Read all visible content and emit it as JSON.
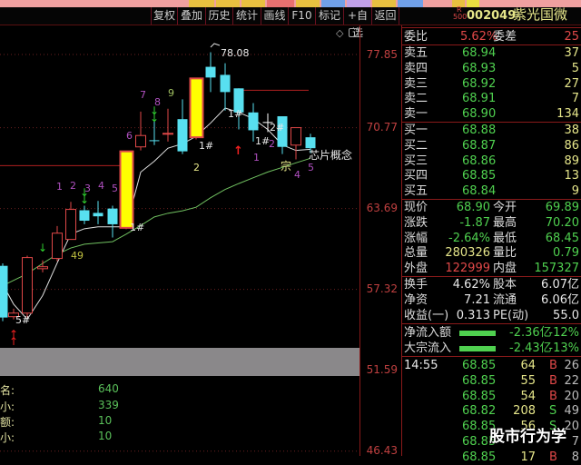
{
  "toolbar": {
    "buttons": [
      "复权",
      "叠加",
      "历史",
      "统计",
      "画线",
      "F10",
      "标记",
      "+自选",
      "返回"
    ]
  },
  "colors": {
    "up": "#e04848",
    "down": "#58e0f0",
    "limit": "#ffff00",
    "ma5": "#e0e0e0",
    "ma_long": "#70c060",
    "accent_green": "#4fd04f"
  },
  "axis": {
    "ticks": [
      "77.85",
      "70.77",
      "63.69",
      "57.32",
      "51.59",
      "46.43"
    ],
    "tick_values": [
      77.85,
      70.77,
      63.69,
      57.32,
      51.59,
      46.43
    ]
  },
  "candles": [
    {
      "o": 59.11,
      "h": 59.3,
      "l": 55.0,
      "c": 55.26,
      "t": "down"
    },
    {
      "o": 55.32,
      "h": 55.9,
      "l": 55.13,
      "c": 55.58,
      "t": "up"
    },
    {
      "o": 55.58,
      "h": 59.9,
      "l": 55.26,
      "c": 59.75,
      "t": "up"
    },
    {
      "o": 58.89,
      "h": 59.54,
      "l": 58.61,
      "c": 59.04,
      "t": "up"
    },
    {
      "o": 59.68,
      "h": 62.26,
      "l": 59.47,
      "c": 61.68,
      "t": "up"
    },
    {
      "o": 61.18,
      "h": 64.25,
      "l": 61.18,
      "c": 63.62,
      "t": "up"
    },
    {
      "o": 63.55,
      "h": 63.93,
      "l": 62.4,
      "c": 62.69,
      "t": "down"
    },
    {
      "o": 63.33,
      "h": 64.33,
      "l": 62.4,
      "c": 63.05,
      "t": "down"
    },
    {
      "o": 63.69,
      "h": 63.93,
      "l": 61.33,
      "c": 62.4,
      "t": "down"
    },
    {
      "o": 62.11,
      "h": 68.62,
      "l": 62.0,
      "c": 68.62,
      "t": "limit"
    },
    {
      "o": 69.02,
      "h": 72.27,
      "l": 68.7,
      "c": 70.05,
      "t": "up"
    },
    {
      "o": 69.62,
      "h": 72.72,
      "l": 69.18,
      "c": 69.54,
      "t": "down"
    },
    {
      "o": 70.17,
      "h": 72.54,
      "l": 69.5,
      "c": 70.25,
      "t": "up"
    },
    {
      "o": 71.56,
      "h": 73.43,
      "l": 68.38,
      "c": 68.62,
      "t": "down"
    },
    {
      "o": 69.89,
      "h": 75.46,
      "l": 69.7,
      "c": 75.46,
      "t": "limit"
    },
    {
      "o": 76.61,
      "h": 78.08,
      "l": 74.13,
      "c": 75.55,
      "t": "down"
    },
    {
      "o": 75.81,
      "h": 76.97,
      "l": 72.36,
      "c": 74.13,
      "t": "down"
    },
    {
      "o": 74.49,
      "h": 74.49,
      "l": 70.61,
      "c": 72.19,
      "t": "down"
    },
    {
      "o": 72.19,
      "h": 73.07,
      "l": 69.5,
      "c": 70.53,
      "t": "down"
    },
    {
      "o": 71.25,
      "h": 72.1,
      "l": 70.37,
      "c": 71.17,
      "t": "doji"
    },
    {
      "o": 71.83,
      "h": 71.83,
      "l": 68.38,
      "c": 69.02,
      "t": "down"
    },
    {
      "o": 69.18,
      "h": 70.77,
      "l": 67.9,
      "c": 70.77,
      "t": "up"
    },
    {
      "o": 69.89,
      "h": 70.21,
      "l": 68.45,
      "c": 68.9,
      "t": "down"
    }
  ],
  "ma_short": [
    57.71,
    56.23,
    55.13,
    56.87,
    59.33,
    61.61,
    62.04,
    62.19,
    62.19,
    62.19,
    66.79,
    67.74,
    68.9,
    69.3,
    69.97,
    71.2,
    72.6,
    72.2,
    71.6,
    70.6,
    69.2,
    68.7,
    68.8
  ],
  "ma_long": [
    57.6,
    58.0,
    58.5,
    59.3,
    60.0,
    60.5,
    60.8,
    60.9,
    61.0,
    61.6,
    62.3,
    63.0,
    63.3,
    63.5,
    63.8,
    64.6,
    65.3,
    65.8,
    66.3,
    66.8,
    67.2,
    67.6,
    68.0
  ],
  "levels": [
    67.35,
    74.31
  ],
  "annotations": {
    "high": "78.08",
    "n1": "1",
    "n2": "2",
    "n3": "3",
    "n4": "4",
    "n5": "5",
    "n6": "6",
    "n7": "7",
    "n8": "8",
    "n9": "9",
    "h5": "5#",
    "ma49": "49",
    "h1a": "1#",
    "two_a": "2",
    "h1b": "1#",
    "h1c": "1#",
    "h1d": "1#",
    "h2": "2#",
    "two_b": "2",
    "one": "1",
    "zong": "宗",
    "four": "4",
    "five": "5",
    "concept": "芯片概念"
  },
  "bottom": [
    {
      "label": "名:",
      "value": "640"
    },
    {
      "label": "小:",
      "value": "339"
    },
    {
      "label": "额:",
      "value": "10"
    },
    {
      "label": "小:",
      "value": "10"
    }
  ],
  "stock": {
    "badge_top": "R",
    "badge_bottom": "500",
    "code": "002049",
    "name": "紫光国微"
  },
  "weibi": {
    "label": "委比",
    "value": "5.62%",
    "diff_label": "委差",
    "diff": "25"
  },
  "asks": [
    {
      "label": "卖五",
      "price": "68.94",
      "vol": "37"
    },
    {
      "label": "卖四",
      "price": "68.93",
      "vol": "5"
    },
    {
      "label": "卖三",
      "price": "68.92",
      "vol": "27"
    },
    {
      "label": "卖二",
      "price": "68.91",
      "vol": "7"
    },
    {
      "label": "卖一",
      "price": "68.90",
      "vol": "134"
    }
  ],
  "bids": [
    {
      "label": "买一",
      "price": "68.88",
      "vol": "38"
    },
    {
      "label": "买二",
      "price": "68.87",
      "vol": "86"
    },
    {
      "label": "买三",
      "price": "68.86",
      "vol": "89"
    },
    {
      "label": "买四",
      "price": "68.85",
      "vol": "13"
    },
    {
      "label": "买五",
      "price": "68.84",
      "vol": "9"
    }
  ],
  "quote": [
    {
      "l1": "现价",
      "v1": "68.90",
      "l2": "今开",
      "v2": "69.89"
    },
    {
      "l1": "涨跌",
      "v1": "-1.87",
      "l2": "最高",
      "v2": "70.20"
    },
    {
      "l1": "涨幅",
      "v1": "-2.64%",
      "l2": "最低",
      "v2": "68.45"
    },
    {
      "l1": "总量",
      "v1": "280326",
      "l2": "量比",
      "v2": "0.79"
    },
    {
      "l1": "外盘",
      "v1": "122999",
      "l2": "内盘",
      "v2": "157327"
    }
  ],
  "fund": [
    {
      "l1": "换手",
      "v1": "4.62%",
      "l2": "股本",
      "v2": "6.07亿"
    },
    {
      "l1": "净资",
      "v1": "7.21",
      "l2": "流通",
      "v2": "6.06亿"
    },
    {
      "l1": "收益(一)",
      "v1": "0.313",
      "l2": "PE(动)",
      "v2": "55.0"
    }
  ],
  "flow": [
    {
      "label": "净流入额",
      "amount": "-2.36亿",
      "pct": "-12%"
    },
    {
      "label": "大宗流入",
      "amount": "-2.43亿",
      "pct": "-13%"
    }
  ],
  "ticks": [
    {
      "time": "14:55",
      "price": "68.85",
      "vol": "64",
      "side": "B",
      "n": "26"
    },
    {
      "time": "",
      "price": "68.85",
      "vol": "55",
      "side": "B",
      "n": "22"
    },
    {
      "time": "",
      "price": "68.85",
      "vol": "54",
      "side": "B",
      "n": "20"
    },
    {
      "time": "",
      "price": "68.82",
      "vol": "208",
      "side": "S",
      "n": "49"
    },
    {
      "time": "",
      "price": "68.85",
      "vol": "56",
      "side": "S",
      "n": "20"
    },
    {
      "time": "",
      "price": "68.85",
      "vol": "",
      "side": "",
      "n": "7"
    },
    {
      "time": "",
      "price": "68.85",
      "vol": "17",
      "side": "B",
      "n": "8"
    }
  ],
  "watermark": "股市行为学"
}
